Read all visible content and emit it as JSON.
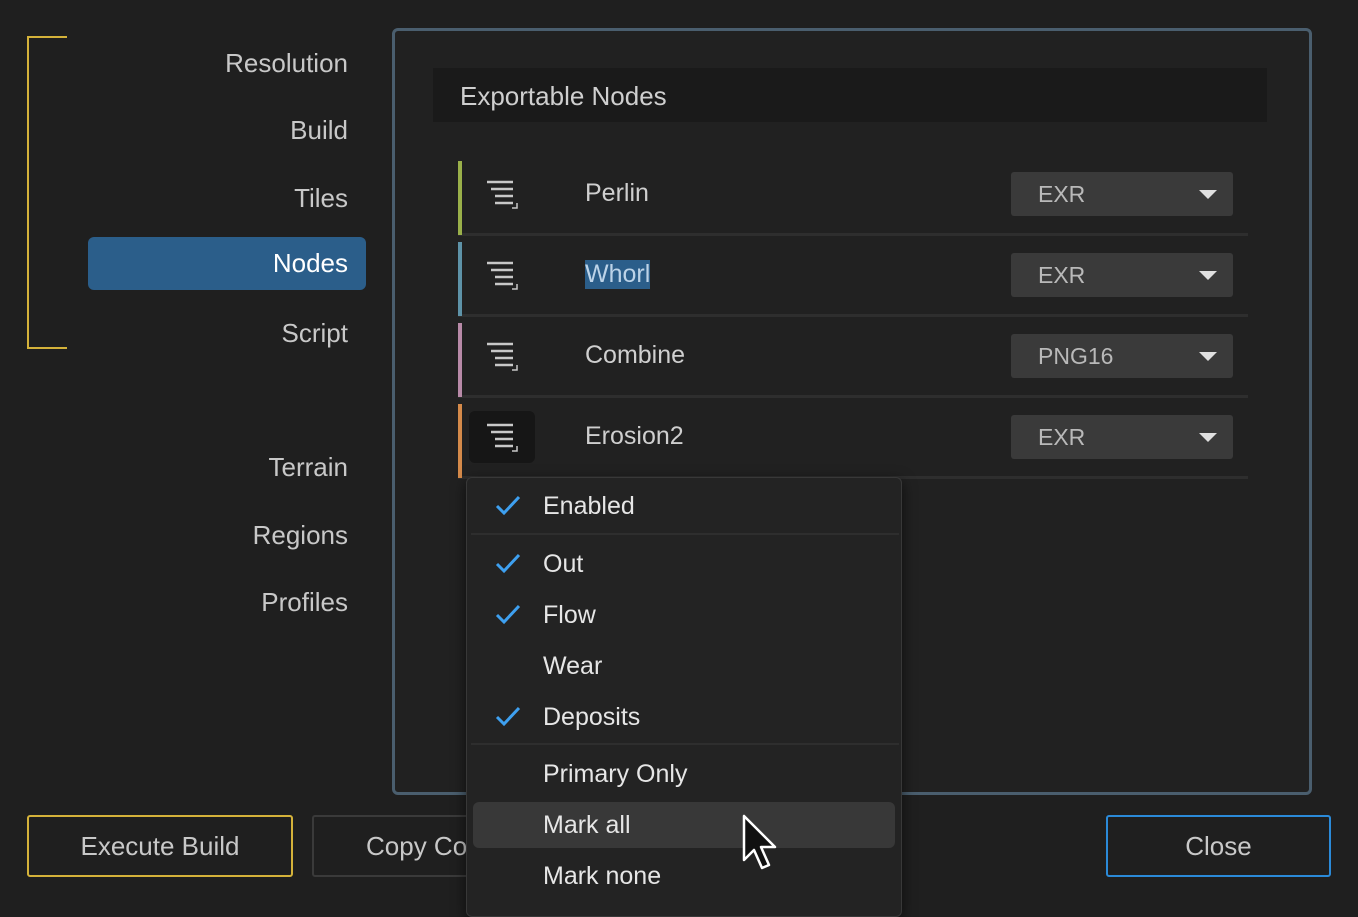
{
  "nav": {
    "group1": [
      "Resolution",
      "Build",
      "Tiles",
      "Nodes",
      "Script"
    ],
    "group2": [
      "Terrain",
      "Regions",
      "Profiles"
    ],
    "active": "Nodes"
  },
  "panel": {
    "title": "Exportable Nodes",
    "nodes": [
      {
        "name": "Perlin",
        "format": "EXR",
        "color": "#9ab04a"
      },
      {
        "name": "Whorl",
        "format": "EXR",
        "color": "#5e93a8"
      },
      {
        "name": "Combine",
        "format": "PNG16",
        "color": "#b88aa8"
      },
      {
        "name": "Erosion2",
        "format": "EXR",
        "color": "#d58a4a"
      }
    ]
  },
  "footer": {
    "execute_label": "Execute Build",
    "copy_label": "Copy Co",
    "close_label": "Close"
  },
  "context_menu": {
    "items": [
      {
        "label": "Enabled",
        "checked": true
      },
      {
        "label": "Out",
        "checked": true
      },
      {
        "label": "Flow",
        "checked": true
      },
      {
        "label": "Wear",
        "checked": false
      },
      {
        "label": "Deposits",
        "checked": true
      },
      {
        "label": "Primary Only",
        "checked": false
      },
      {
        "label": "Mark all",
        "checked": false
      },
      {
        "label": "Mark none",
        "checked": false
      }
    ],
    "hovered": "Mark all"
  },
  "colors": {
    "accent_yellow": "#d4b23a",
    "accent_blue": "#2b5e8a",
    "check_blue": "#3ea0f0"
  }
}
